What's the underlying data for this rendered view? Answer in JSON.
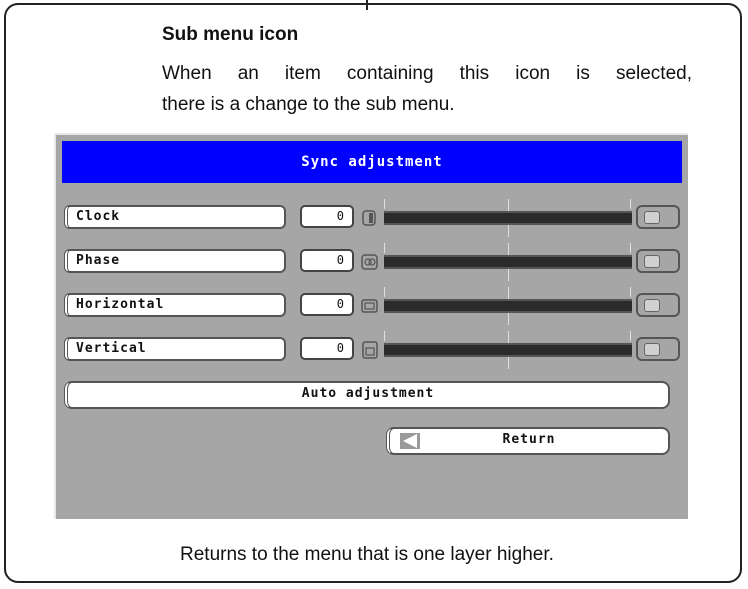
{
  "doc": {
    "heading": "Sub menu icon",
    "line1": "When an item containing this icon is selected,",
    "line2": "there is a change to the sub menu.",
    "caption": "Returns to the menu that is one layer higher."
  },
  "osd": {
    "title": "Sync adjustment",
    "rows": [
      {
        "label": "Clock",
        "value": "0",
        "icon": "clock-icon"
      },
      {
        "label": "Phase",
        "value": "0",
        "icon": "phase-icon"
      },
      {
        "label": "Horizontal",
        "value": "0",
        "icon": "horizontal-position-icon"
      },
      {
        "label": "Vertical",
        "value": "0",
        "icon": "vertical-position-icon"
      }
    ],
    "auto_adjustment": "Auto adjustment",
    "return": "Return"
  },
  "colors": {
    "title_bg": "#0000ff",
    "panel_bg": "#a6a6a6",
    "bar": "#2b2b2b"
  }
}
